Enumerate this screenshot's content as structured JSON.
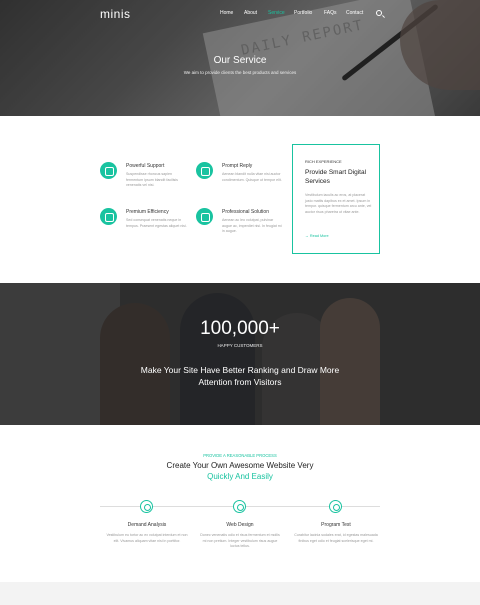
{
  "header": {
    "logo": "minis",
    "nav": [
      "Home",
      "About",
      "Service",
      "Portfolio",
      "FAQs",
      "Contact"
    ],
    "active_nav": "Service"
  },
  "hero": {
    "title": "Our Service",
    "subtitle": "We aim to provide clients the best products and services"
  },
  "features": [
    {
      "title": "Powerful Support",
      "text": "Suspendisse rhoncus sapien fermentum ipsum blandit facilisis venenatis vel nisi.",
      "icon": "support-icon"
    },
    {
      "title": "Prompt Reply",
      "text": "Aenean blandit nulla vitae nisi auctor condimentum. Quisque ut tempor elit.",
      "icon": "chat-icon"
    },
    {
      "title": "Premium Efficiency",
      "text": "Sed consequat venenatis neque in tempus. Praesent egestas aliquet nisi.",
      "icon": "chart-icon"
    },
    {
      "title": "Professional Solution",
      "text": "Aenean ac leo volutpat, pulvinar augue ac, imperdiet nisi. In feugiat mi in augue.",
      "icon": "clipboard-icon"
    }
  ],
  "card": {
    "kicker": "RICH EXPERIENCE",
    "title": "Provide Smart Digital Services",
    "text": "Vestibulum iaculis ac eros, at placerat justo mattis dapibus ex et amet. Ipsum in tempor. quisque fermentum arcu ante, vel auctor risus pharetra ut vitae ante.",
    "link": "Read More"
  },
  "stats": {
    "value": "100,000+",
    "label": "HAPPY CUSTOMERS",
    "tagline": "Make Your Site Have Better Ranking and Draw More Attention from Visitors"
  },
  "process": {
    "kicker": "PROVIDE A REASONABLE PROCESS",
    "title": "Create Your Own Awesome Website Very",
    "title_highlight": "Quickly And Easily",
    "steps": [
      {
        "title": "Demand Analysis",
        "text": "Vestibulum eu tortor ac ex volutpat interdum et non elit. Vivamus aliquam vitae nisi in porttitor."
      },
      {
        "title": "Web Design",
        "text": "Donec venenatis odio et risus fermentum et mollis mi non pretium. Integer vestibulum risus augue luctus tellus."
      },
      {
        "title": "Program Test",
        "text": "Curabitur lacinia sodales erat, id egestas malesuada finibus eget odio et feugiat scelerisque eget mi."
      }
    ]
  },
  "colors": {
    "accent": "#19c3a0"
  }
}
